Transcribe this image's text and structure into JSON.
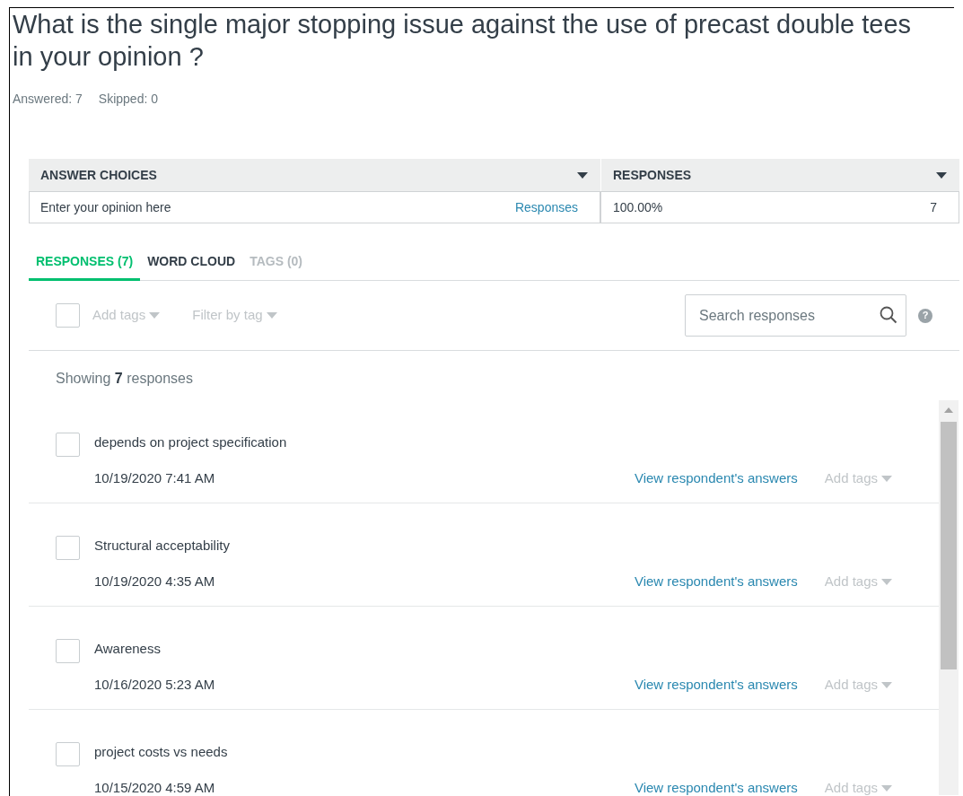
{
  "question": {
    "title": "What is the single major stopping issue against the use of precast double tees in your opinion ?",
    "answered": "Answered: 7",
    "skipped": "Skipped: 0"
  },
  "table": {
    "columns": [
      "ANSWER CHOICES",
      "RESPONSES"
    ],
    "rows": [
      {
        "choice": "Enter your opinion here",
        "link": "Responses",
        "percent": "100.00%",
        "count": "7"
      }
    ]
  },
  "tabs": [
    {
      "label": "RESPONSES (7)",
      "selected": true,
      "disabled": false
    },
    {
      "label": "WORD CLOUD",
      "selected": false,
      "disabled": false
    },
    {
      "label": "TAGS (0)",
      "selected": false,
      "disabled": true
    }
  ],
  "toolbar": {
    "select_all_checked": false,
    "add_tags": "Add tags",
    "filter_by_tag": "Filter by tag",
    "search": {
      "placeholder": "Search responses"
    },
    "help": "?"
  },
  "showing": "Showing **7** responses",
  "responses": [
    {
      "text": "depends on project specification",
      "date": "10/19/2020 7:41 AM",
      "link": "View respondent's answers",
      "tags": "Add tags",
      "checked": false
    },
    {
      "text": "Structural acceptability",
      "date": "10/19/2020 4:35 AM",
      "link": "View respondent's answers",
      "tags": "Add tags",
      "checked": false
    },
    {
      "text": "Awareness",
      "date": "10/16/2020 5:23 AM",
      "link": "View respondent's answers",
      "tags": "Add tags",
      "checked": false
    },
    {
      "text": "project costs vs needs",
      "date": "10/15/2020 4:59 AM",
      "link": "View respondent's answers",
      "tags": "Add tags",
      "checked": false
    }
  ]
}
